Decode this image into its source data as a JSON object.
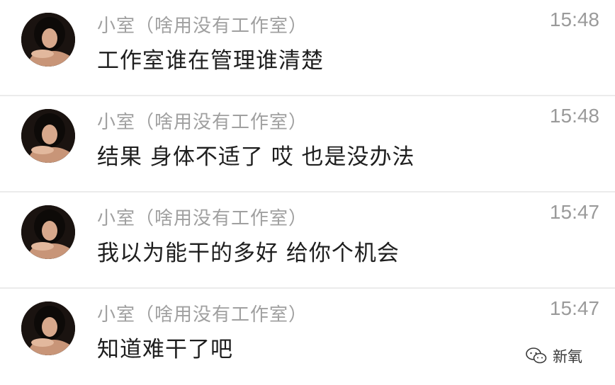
{
  "messages": [
    {
      "sender": "小室（啥用没有工作室）",
      "time": "15:48",
      "text": "工作室谁在管理谁清楚"
    },
    {
      "sender": "小室（啥用没有工作室）",
      "time": "15:48",
      "text": "结果 身体不适了 哎 也是没办法"
    },
    {
      "sender": "小室（啥用没有工作室）",
      "time": "15:47",
      "text": "我以为能干的多好 给你个机会"
    },
    {
      "sender": "小室（啥用没有工作室）",
      "time": "15:47",
      "text": "知道难干了吧"
    }
  ],
  "watermark": {
    "icon": "wechat-icon",
    "text": "新氧"
  },
  "colors": {
    "sender": "#a0a0a0",
    "message": "#1e1e1e",
    "time": "#9a9a9a",
    "divider": "#ebebeb"
  }
}
